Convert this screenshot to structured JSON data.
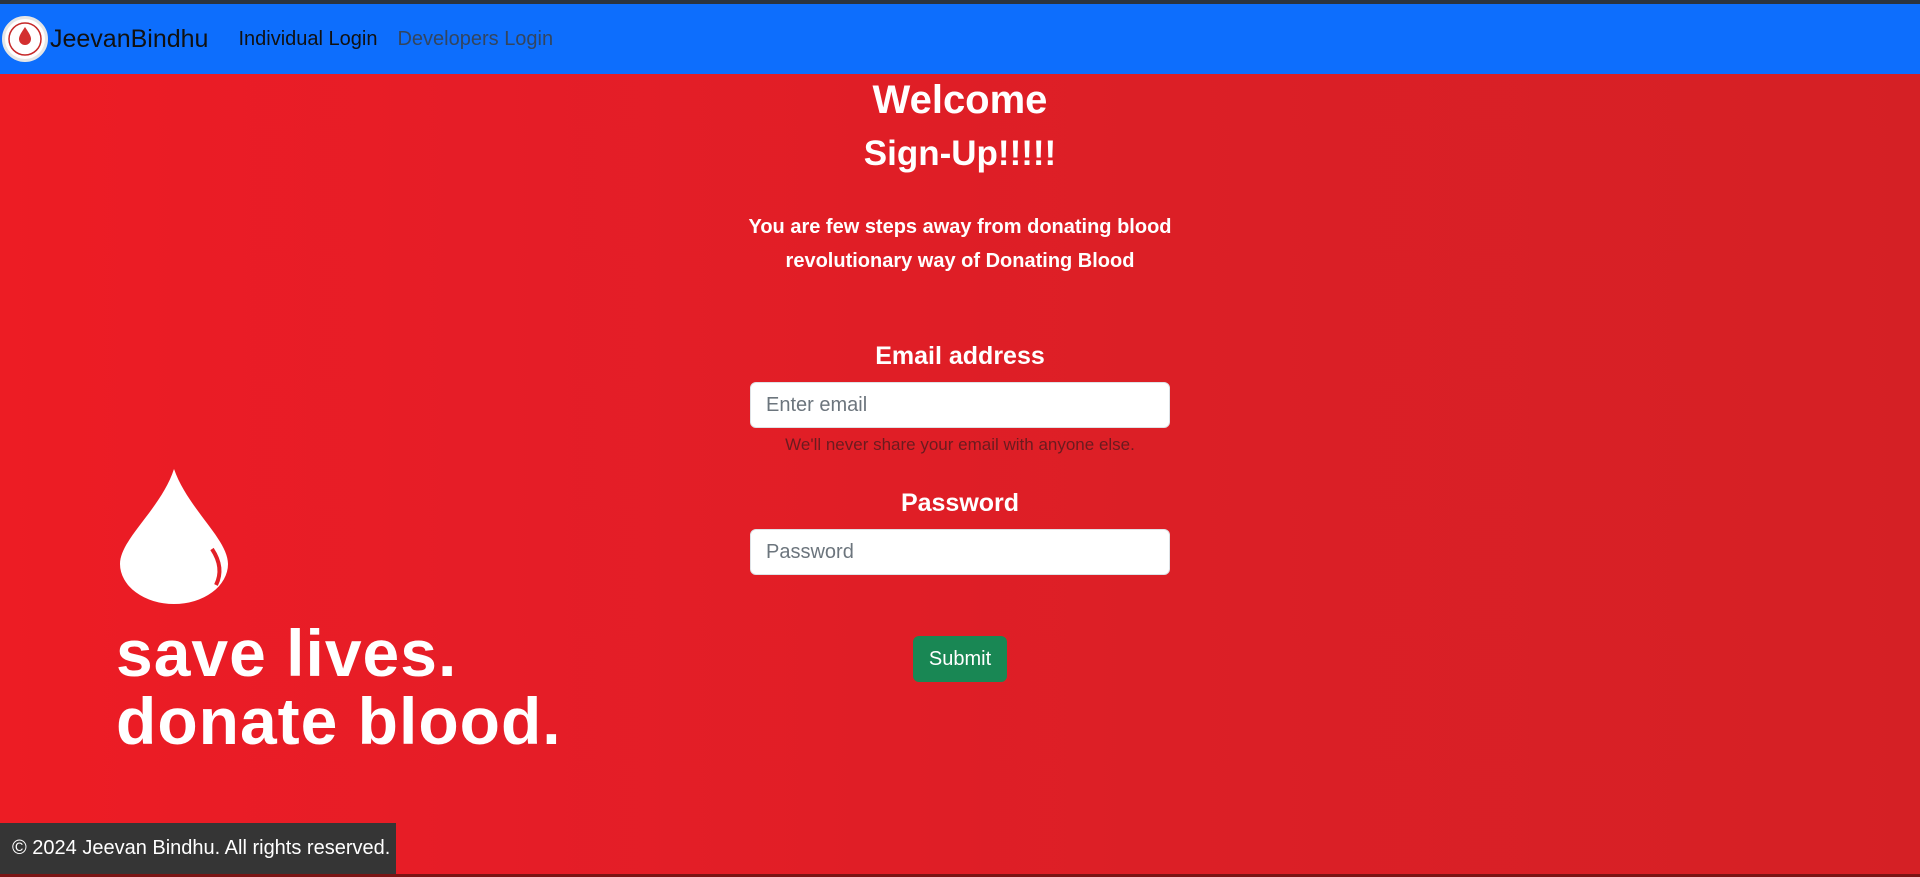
{
  "nav": {
    "brand": "JeevanBindhu",
    "logo_text": "BLOOD",
    "links": [
      {
        "label": "Individual Login"
      },
      {
        "label": "Developers Login"
      }
    ]
  },
  "hero": {
    "welcome": "Welcome",
    "signup": "Sign-Up!!!!!",
    "line1": "You are few steps away from donating blood",
    "line2": "revolutionary way of Donating Blood"
  },
  "form": {
    "email_label": "Email address",
    "email_placeholder": "Enter email",
    "email_value": "",
    "email_help": "We'll never share your email with anyone else.",
    "password_label": "Password",
    "password_placeholder": "Password",
    "password_value": "",
    "submit_label": "Submit"
  },
  "banner": {
    "line1": "save lives.",
    "line2": "donate blood."
  },
  "footer": {
    "text": "© 2024 Jeevan Bindhu. All rights reserved."
  },
  "colors": {
    "navbar": "#0d6efd",
    "background": "#e01e26",
    "submit": "#198754",
    "footer": "#353535"
  }
}
